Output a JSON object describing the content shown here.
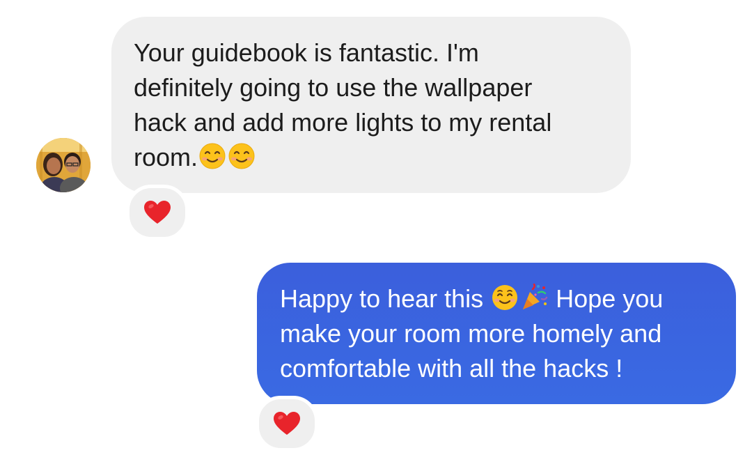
{
  "messages": [
    {
      "direction": "incoming",
      "text_part1": "Your guidebook is fantastic. I'm\ndefinitely going to use the wallpaper\nhack and add more lights to my rental\nroom.",
      "trailing_emojis": [
        "smiling-face-icon",
        "smiling-face-icon"
      ],
      "reaction": "red-heart-icon"
    },
    {
      "direction": "outgoing",
      "text_part1": "Happy to hear this ",
      "inline_emojis": [
        "smiling-face-icon",
        "party-popper-icon"
      ],
      "text_part2": " Hope you\nmake your room more homely and\ncomfortable with all the hacks !",
      "reaction": "red-heart-icon"
    }
  ],
  "colors": {
    "incoming_bubble": "#efefef",
    "outgoing_bubble": "#3b63df",
    "incoming_text": "#1c1c1c",
    "outgoing_text": "#ffffff",
    "heart": "#e8242b"
  }
}
